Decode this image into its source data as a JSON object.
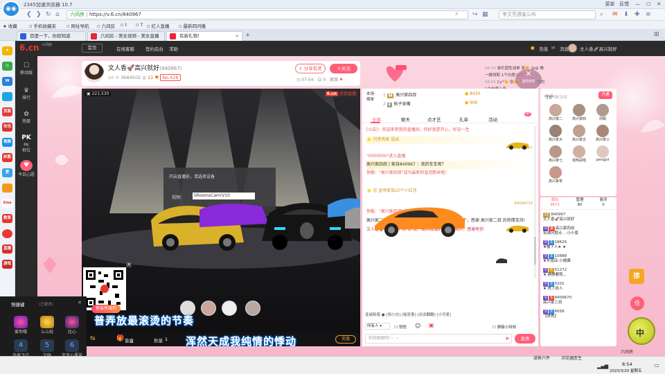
{
  "browser": {
    "title": "2345加速浏览器 10.7",
    "titlebar_right": [
      "菜单",
      "反馈",
      "—",
      "☐",
      "✕"
    ],
    "url": "https://v.6.cn/840967",
    "url_prefix": "六间房",
    "search_placeholder": "李文亮遇害公布",
    "bookmarks": [
      "收藏",
      "手机收藏夹",
      "网址导航",
      "六间房",
      "t",
      "T",
      "红人直播",
      "最新四问播"
    ],
    "tabs": [
      {
        "label": "百度一下，你就知道",
        "active": false
      },
      {
        "label": "六间房 - 美女视频 - 美女直播",
        "active": false
      },
      {
        "label": "有新礼物！",
        "active": true
      }
    ]
  },
  "browser_sidebar": [
    "★",
    "◷",
    "W",
    "",
    "页面",
    "车讯",
    "视频",
    "炒股",
    "爱",
    "",
    "Sina",
    "教育",
    "",
    "直播",
    "游戏"
  ],
  "site": {
    "logo": "6.cn",
    "logo_sub": "六间房",
    "home": "首页",
    "nav": [
      "在线客服",
      "签约后台",
      "求助"
    ],
    "header_right": {
      "recharge": "充值",
      "msg": "消息",
      "user": "文人香🚀高兴就好"
    },
    "side_nav": [
      {
        "icon": "☐",
        "label": "移动版"
      },
      {
        "icon": "♛",
        "label": "排行"
      },
      {
        "icon": "✿",
        "label": "热度"
      },
      {
        "icon": "PK",
        "label": "PK\n担位"
      },
      {
        "icon": "♥",
        "label": "今日心愿"
      }
    ]
  },
  "room": {
    "name": "文人香🚀高兴就好",
    "id": "(840967)",
    "level": "10",
    "fans_count": "3684502",
    "level2": "11",
    "rank_badge": "No.428",
    "share": "分享有奖",
    "follow": "关注",
    "time": "07:54",
    "online": "0",
    "home_label": "家族"
  },
  "gift_notice": {
    "rows": [
      {
        "time": "08:55",
        "text": "游乐园性战单 张🌼 @@ 佛一瞬领取 1个白度小穴"
      },
      {
        "time": "08:55",
        "text": "Cy*🐤 张🌼 🐤 0 小白鬼的 1个白度心岛"
      }
    ],
    "close_label": "退除特效"
  },
  "video": {
    "viewers": "221,530",
    "badge": "6.cn",
    "badge2": "手机直播",
    "open_live": "开启直播前，请选择设备",
    "video_label": "视频：",
    "video_device": "SRoomsCam(V10",
    "lyric1": "普弄放最滚烫的节奏",
    "lyric2": "浑然天成我纯情的悸动",
    "banner": "参会有强烈",
    "gift_box": "盲盒",
    "count_label": "数量",
    "count_value": "1",
    "recharge": "充值"
  },
  "chat": {
    "ranking": [
      {
        "rank": "1",
        "name": "高兴家四叔",
        "coin": "8430"
      },
      {
        "rank": "2",
        "name": "帐子食嘴",
        "coin": "900"
      }
    ],
    "rank_label": "本场\n榜单",
    "tabs": [
      "全部",
      "聊天",
      "点才艺",
      "礼单",
      "活动"
    ],
    "tab_badge": "97",
    "messages": [
      {
        "text": "[公告]：欢迎来到我的直播间，你好我是开心，好运一生",
        "cls": "sys"
      },
      {
        "text": "⭐ 闪亮亮家 送出",
        "cls": "gift"
      },
      {
        "text": "234131187",
        "cls": "gift"
      },
      {
        "text": "\"0000000\"进入直播",
        "cls": "enter"
      },
      {
        "text": "高兴家四叔 | 家自840967 ：我的车车呢？",
        "cls": "normal"
      },
      {
        "text": "快报：\"高兴家四叔\"成为最新的皇冠粉丝啦！",
        "cls": "sys"
      },
      {
        "text": "⭐ 送 皇帝家族20个小红花",
        "cls": "gift"
      },
      {
        "text": "840967(0",
        "cls": "gift"
      },
      {
        "text": "快报：\"高兴家四叔\"成为最新的皇冠粉丝啦！",
        "cls": "sys"
      },
      {
        "text": "高兴家二叔 向 文人香🚀高兴就好 送 赛车车队，共1个，感谢 高兴家二叔 的热情支持!",
        "cls": "normal"
      },
      {
        "text": "文人香🚀高兴就好 对 你 说：期待真诚的守护与陪伴，感谢有你",
        "cls": "whisper"
      }
    ],
    "quick": "连城新版",
    "quick_items": [
      "[闹小白]",
      "[秘答客]",
      "[谈谈翻翻]",
      "[小可爱]"
    ],
    "all_label": "所有人",
    "private": "悄悄",
    "input_placeholder": "和我聊聊吧 ~ ~",
    "send": "发表",
    "hide_effect": "屏蔽小特效"
  },
  "guard": {
    "title": "守护",
    "count": "(8/10)",
    "open": "开通",
    "members": [
      "高兴家二",
      "高兴家四",
      "闲暇",
      "高兴家大",
      "高兴家五",
      "高兴家三",
      "高兴家七",
      "观热闹啦",
      "pengpii",
      "高兴家零"
    ]
  },
  "fans": {
    "tabs": [
      {
        "label": "观众",
        "count": "3671"
      },
      {
        "label": "管理",
        "count": "80"
      },
      {
        "label": "麦序",
        "count": "0"
      }
    ],
    "list": [
      {
        "name": "840967",
        "sub": "文人香🚀高兴就好"
      },
      {
        "name": "高兴家四叔",
        "sub": "有谁问题点 ...小小豪"
      },
      {
        "name": "18626",
        "sub": "★楼下人★ ★"
      },
      {
        "name": "10888",
        "sub": "★东南亚·小偶偶"
      },
      {
        "name": "51272",
        "sub": "★ 静静要我..."
      },
      {
        "name": "0201",
        "sub": "★ 陈下妖人"
      },
      {
        "name": "8409670",
        "sub": "高兴家二叔"
      },
      {
        "name": "6658",
        "sub": "【秀秀】"
      }
    ]
  },
  "shortcut": {
    "title": "快捷键",
    "hint": "(已更改)",
    "items": [
      {
        "key": "1",
        "label": "爱你哦"
      },
      {
        "key": "2",
        "label": "么么哒"
      },
      {
        "key": "3",
        "label": "比心"
      },
      {
        "key": "4",
        "label": "马来飞过"
      },
      {
        "key": "5",
        "label": "欠码"
      },
      {
        "key": "6",
        "label": "宝宝心里苦"
      }
    ]
  },
  "taskbar": {
    "time": "8:54",
    "date": "2020/3/20 星期五",
    "items": [
      "湖景六件",
      "浏览器医生"
    ],
    "side_text": "六间房"
  },
  "colors": {
    "accent": "#ff5f77",
    "brand": "#e8382e",
    "pink_bg": "#f7cdd9",
    "dark_nav": "#2a2a2a"
  }
}
